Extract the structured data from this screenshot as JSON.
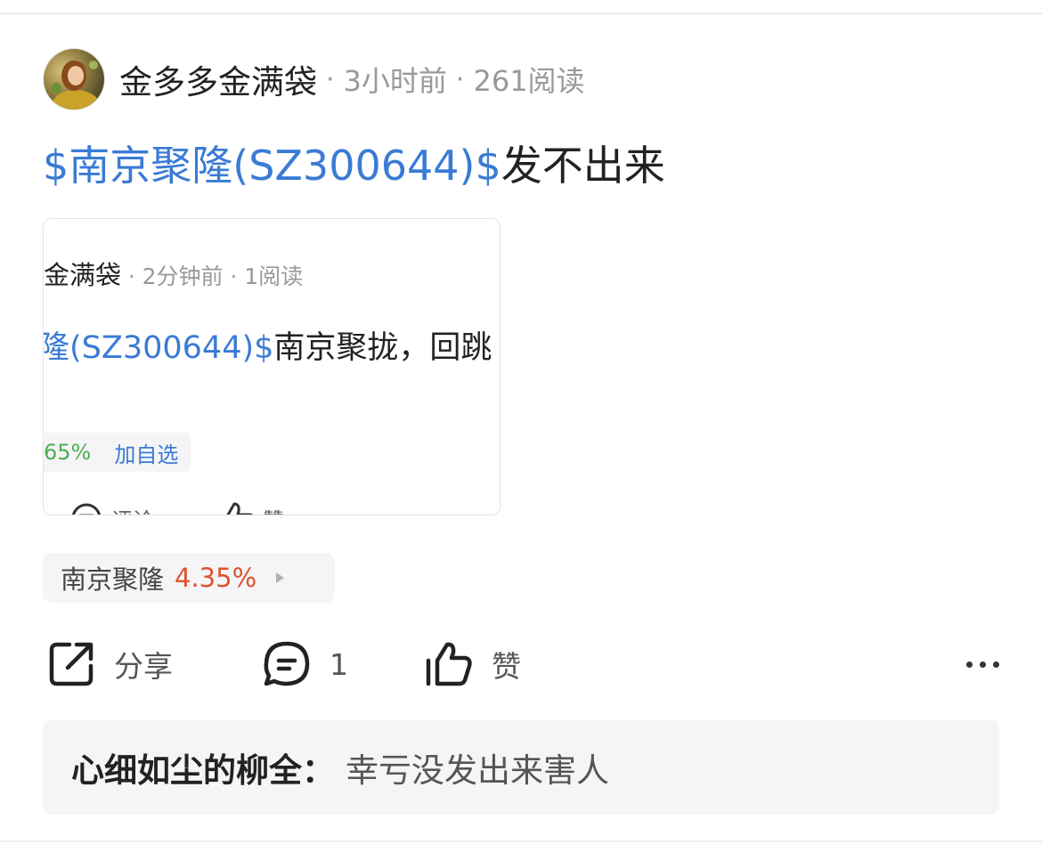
{
  "post": {
    "author": "金多多金满袋",
    "separator": "·",
    "time": "3小时前",
    "reads": "261阅读",
    "stock_link": "$南京聚隆(SZ300644)$",
    "body_text": "发不出来"
  },
  "quoted": {
    "author_partial": "金满袋",
    "time": "2分钟前",
    "reads": "1阅读",
    "stock_link_partial": "隆(SZ300644)$",
    "body_partial": "南京聚拢，回跳",
    "chip_percent": "65%",
    "chip_add": "加自选",
    "comment_label": "评论",
    "like_label": "赞"
  },
  "stock_tag": {
    "name": "南京聚隆",
    "percent": "4.35%"
  },
  "actions": {
    "share_label": "分享",
    "comment_count": "1",
    "like_label": "赞"
  },
  "comment": {
    "author": "心细如尘的柳全",
    "colon": "：",
    "text": "幸亏没发出来害人"
  },
  "colors": {
    "link_blue": "#3a7bd5",
    "up_red": "#e0522e",
    "up_green": "#4caf50"
  },
  "icons": [
    "avatar",
    "share-icon",
    "comment-icon",
    "like-icon",
    "more-icon",
    "chevron-right-icon"
  ]
}
